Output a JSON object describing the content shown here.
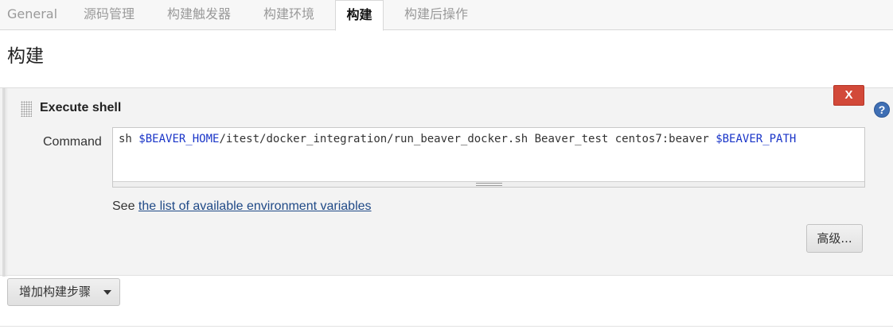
{
  "tabs": [
    {
      "label": "General"
    },
    {
      "label": "源码管理"
    },
    {
      "label": "构建触发器"
    },
    {
      "label": "构建环境"
    },
    {
      "label": "构建",
      "active": true
    },
    {
      "label": "构建后操作"
    }
  ],
  "page_title": "构建",
  "build_step": {
    "title": "Execute shell",
    "delete_label": "X",
    "help_label": "?",
    "command_label": "Command",
    "command": {
      "p1": "sh ",
      "v1": "$BEAVER_HOME",
      "p2": "/itest/docker_integration/run_beaver_docker.sh Beaver_test centos7:beaver ",
      "v2": "$BEAVER_PATH"
    },
    "see_prefix": "See ",
    "see_link": "the list of available environment variables",
    "advanced_label": "高级..."
  },
  "add_step": {
    "label": "增加构建步骤"
  },
  "colors": {
    "delete": "#d24939",
    "help": "#3f6fb4",
    "link": "#204a87",
    "variable": "#1a35c8"
  },
  "icons": [
    "drag-handle-icon",
    "help-icon",
    "caret-down-icon"
  ]
}
